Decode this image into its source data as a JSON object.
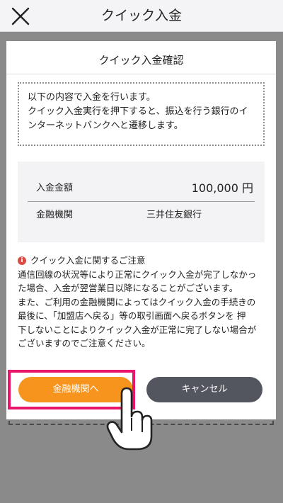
{
  "header": {
    "title": "クイック入金",
    "close_icon": "close-icon"
  },
  "modal": {
    "title": "クイック入金確認",
    "info_lines": [
      "以下の内容で入金を行います。",
      "クイック入金実行を押下すると、振込を行う銀行のイ",
      "ンターネットバンクへと遷移します。"
    ],
    "details": [
      {
        "label": "入金金額",
        "value": "100,000 円"
      },
      {
        "label": "金融機関",
        "value": "三井住友銀行"
      }
    ],
    "notice": {
      "icon": "info-icon",
      "title": "クイック入金に関するご注意",
      "lines": [
        "通信回線の状況等により正常にクイック入金が完了しなかっ",
        "た場合、入金が翌営業日以降になることがございます。",
        "また、ご利用の金融機関によってはクイック入金の手続きの",
        "最後に、「加盟店へ戻る」等の取引画面へ戻るボタンを 押",
        "下しないことによりクイック入金が正常に完了しない場合が",
        "ございますのでご注意ください。"
      ]
    },
    "buttons": {
      "primary_label": "金融機関へ",
      "secondary_label": "キャンセル"
    }
  },
  "colors": {
    "primary_button": "#f7941d",
    "secondary_button": "#53555f",
    "highlight": "#e8156b",
    "overlay": "#8a8a8a"
  }
}
